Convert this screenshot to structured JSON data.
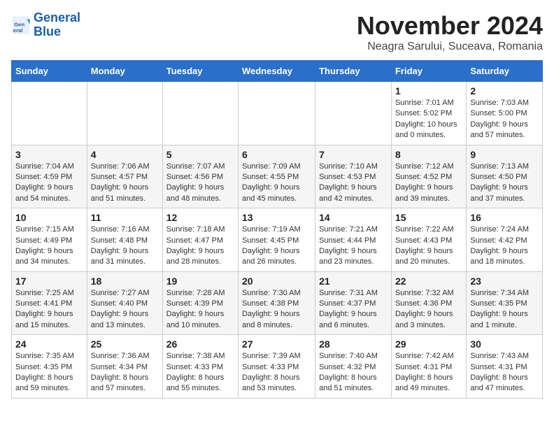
{
  "logo": {
    "line1": "General",
    "line2": "Blue"
  },
  "header": {
    "title": "November 2024",
    "subtitle": "Neagra Sarului, Suceava, Romania"
  },
  "weekdays": [
    "Sunday",
    "Monday",
    "Tuesday",
    "Wednesday",
    "Thursday",
    "Friday",
    "Saturday"
  ],
  "weeks": [
    [
      {
        "day": "",
        "detail": ""
      },
      {
        "day": "",
        "detail": ""
      },
      {
        "day": "",
        "detail": ""
      },
      {
        "day": "",
        "detail": ""
      },
      {
        "day": "",
        "detail": ""
      },
      {
        "day": "1",
        "detail": "Sunrise: 7:01 AM\nSunset: 5:02 PM\nDaylight: 10 hours and 0 minutes."
      },
      {
        "day": "2",
        "detail": "Sunrise: 7:03 AM\nSunset: 5:00 PM\nDaylight: 9 hours and 57 minutes."
      }
    ],
    [
      {
        "day": "3",
        "detail": "Sunrise: 7:04 AM\nSunset: 4:59 PM\nDaylight: 9 hours and 54 minutes."
      },
      {
        "day": "4",
        "detail": "Sunrise: 7:06 AM\nSunset: 4:57 PM\nDaylight: 9 hours and 51 minutes."
      },
      {
        "day": "5",
        "detail": "Sunrise: 7:07 AM\nSunset: 4:56 PM\nDaylight: 9 hours and 48 minutes."
      },
      {
        "day": "6",
        "detail": "Sunrise: 7:09 AM\nSunset: 4:55 PM\nDaylight: 9 hours and 45 minutes."
      },
      {
        "day": "7",
        "detail": "Sunrise: 7:10 AM\nSunset: 4:53 PM\nDaylight: 9 hours and 42 minutes."
      },
      {
        "day": "8",
        "detail": "Sunrise: 7:12 AM\nSunset: 4:52 PM\nDaylight: 9 hours and 39 minutes."
      },
      {
        "day": "9",
        "detail": "Sunrise: 7:13 AM\nSunset: 4:50 PM\nDaylight: 9 hours and 37 minutes."
      }
    ],
    [
      {
        "day": "10",
        "detail": "Sunrise: 7:15 AM\nSunset: 4:49 PM\nDaylight: 9 hours and 34 minutes."
      },
      {
        "day": "11",
        "detail": "Sunrise: 7:16 AM\nSunset: 4:48 PM\nDaylight: 9 hours and 31 minutes."
      },
      {
        "day": "12",
        "detail": "Sunrise: 7:18 AM\nSunset: 4:47 PM\nDaylight: 9 hours and 28 minutes."
      },
      {
        "day": "13",
        "detail": "Sunrise: 7:19 AM\nSunset: 4:45 PM\nDaylight: 9 hours and 26 minutes."
      },
      {
        "day": "14",
        "detail": "Sunrise: 7:21 AM\nSunset: 4:44 PM\nDaylight: 9 hours and 23 minutes."
      },
      {
        "day": "15",
        "detail": "Sunrise: 7:22 AM\nSunset: 4:43 PM\nDaylight: 9 hours and 20 minutes."
      },
      {
        "day": "16",
        "detail": "Sunrise: 7:24 AM\nSunset: 4:42 PM\nDaylight: 9 hours and 18 minutes."
      }
    ],
    [
      {
        "day": "17",
        "detail": "Sunrise: 7:25 AM\nSunset: 4:41 PM\nDaylight: 9 hours and 15 minutes."
      },
      {
        "day": "18",
        "detail": "Sunrise: 7:27 AM\nSunset: 4:40 PM\nDaylight: 9 hours and 13 minutes."
      },
      {
        "day": "19",
        "detail": "Sunrise: 7:28 AM\nSunset: 4:39 PM\nDaylight: 9 hours and 10 minutes."
      },
      {
        "day": "20",
        "detail": "Sunrise: 7:30 AM\nSunset: 4:38 PM\nDaylight: 9 hours and 8 minutes."
      },
      {
        "day": "21",
        "detail": "Sunrise: 7:31 AM\nSunset: 4:37 PM\nDaylight: 9 hours and 6 minutes."
      },
      {
        "day": "22",
        "detail": "Sunrise: 7:32 AM\nSunset: 4:36 PM\nDaylight: 9 hours and 3 minutes."
      },
      {
        "day": "23",
        "detail": "Sunrise: 7:34 AM\nSunset: 4:35 PM\nDaylight: 9 hours and 1 minute."
      }
    ],
    [
      {
        "day": "24",
        "detail": "Sunrise: 7:35 AM\nSunset: 4:35 PM\nDaylight: 8 hours and 59 minutes."
      },
      {
        "day": "25",
        "detail": "Sunrise: 7:36 AM\nSunset: 4:34 PM\nDaylight: 8 hours and 57 minutes."
      },
      {
        "day": "26",
        "detail": "Sunrise: 7:38 AM\nSunset: 4:33 PM\nDaylight: 8 hours and 55 minutes."
      },
      {
        "day": "27",
        "detail": "Sunrise: 7:39 AM\nSunset: 4:33 PM\nDaylight: 8 hours and 53 minutes."
      },
      {
        "day": "28",
        "detail": "Sunrise: 7:40 AM\nSunset: 4:32 PM\nDaylight: 8 hours and 51 minutes."
      },
      {
        "day": "29",
        "detail": "Sunrise: 7:42 AM\nSunset: 4:31 PM\nDaylight: 8 hours and 49 minutes."
      },
      {
        "day": "30",
        "detail": "Sunrise: 7:43 AM\nSunset: 4:31 PM\nDaylight: 8 hours and 47 minutes."
      }
    ]
  ]
}
